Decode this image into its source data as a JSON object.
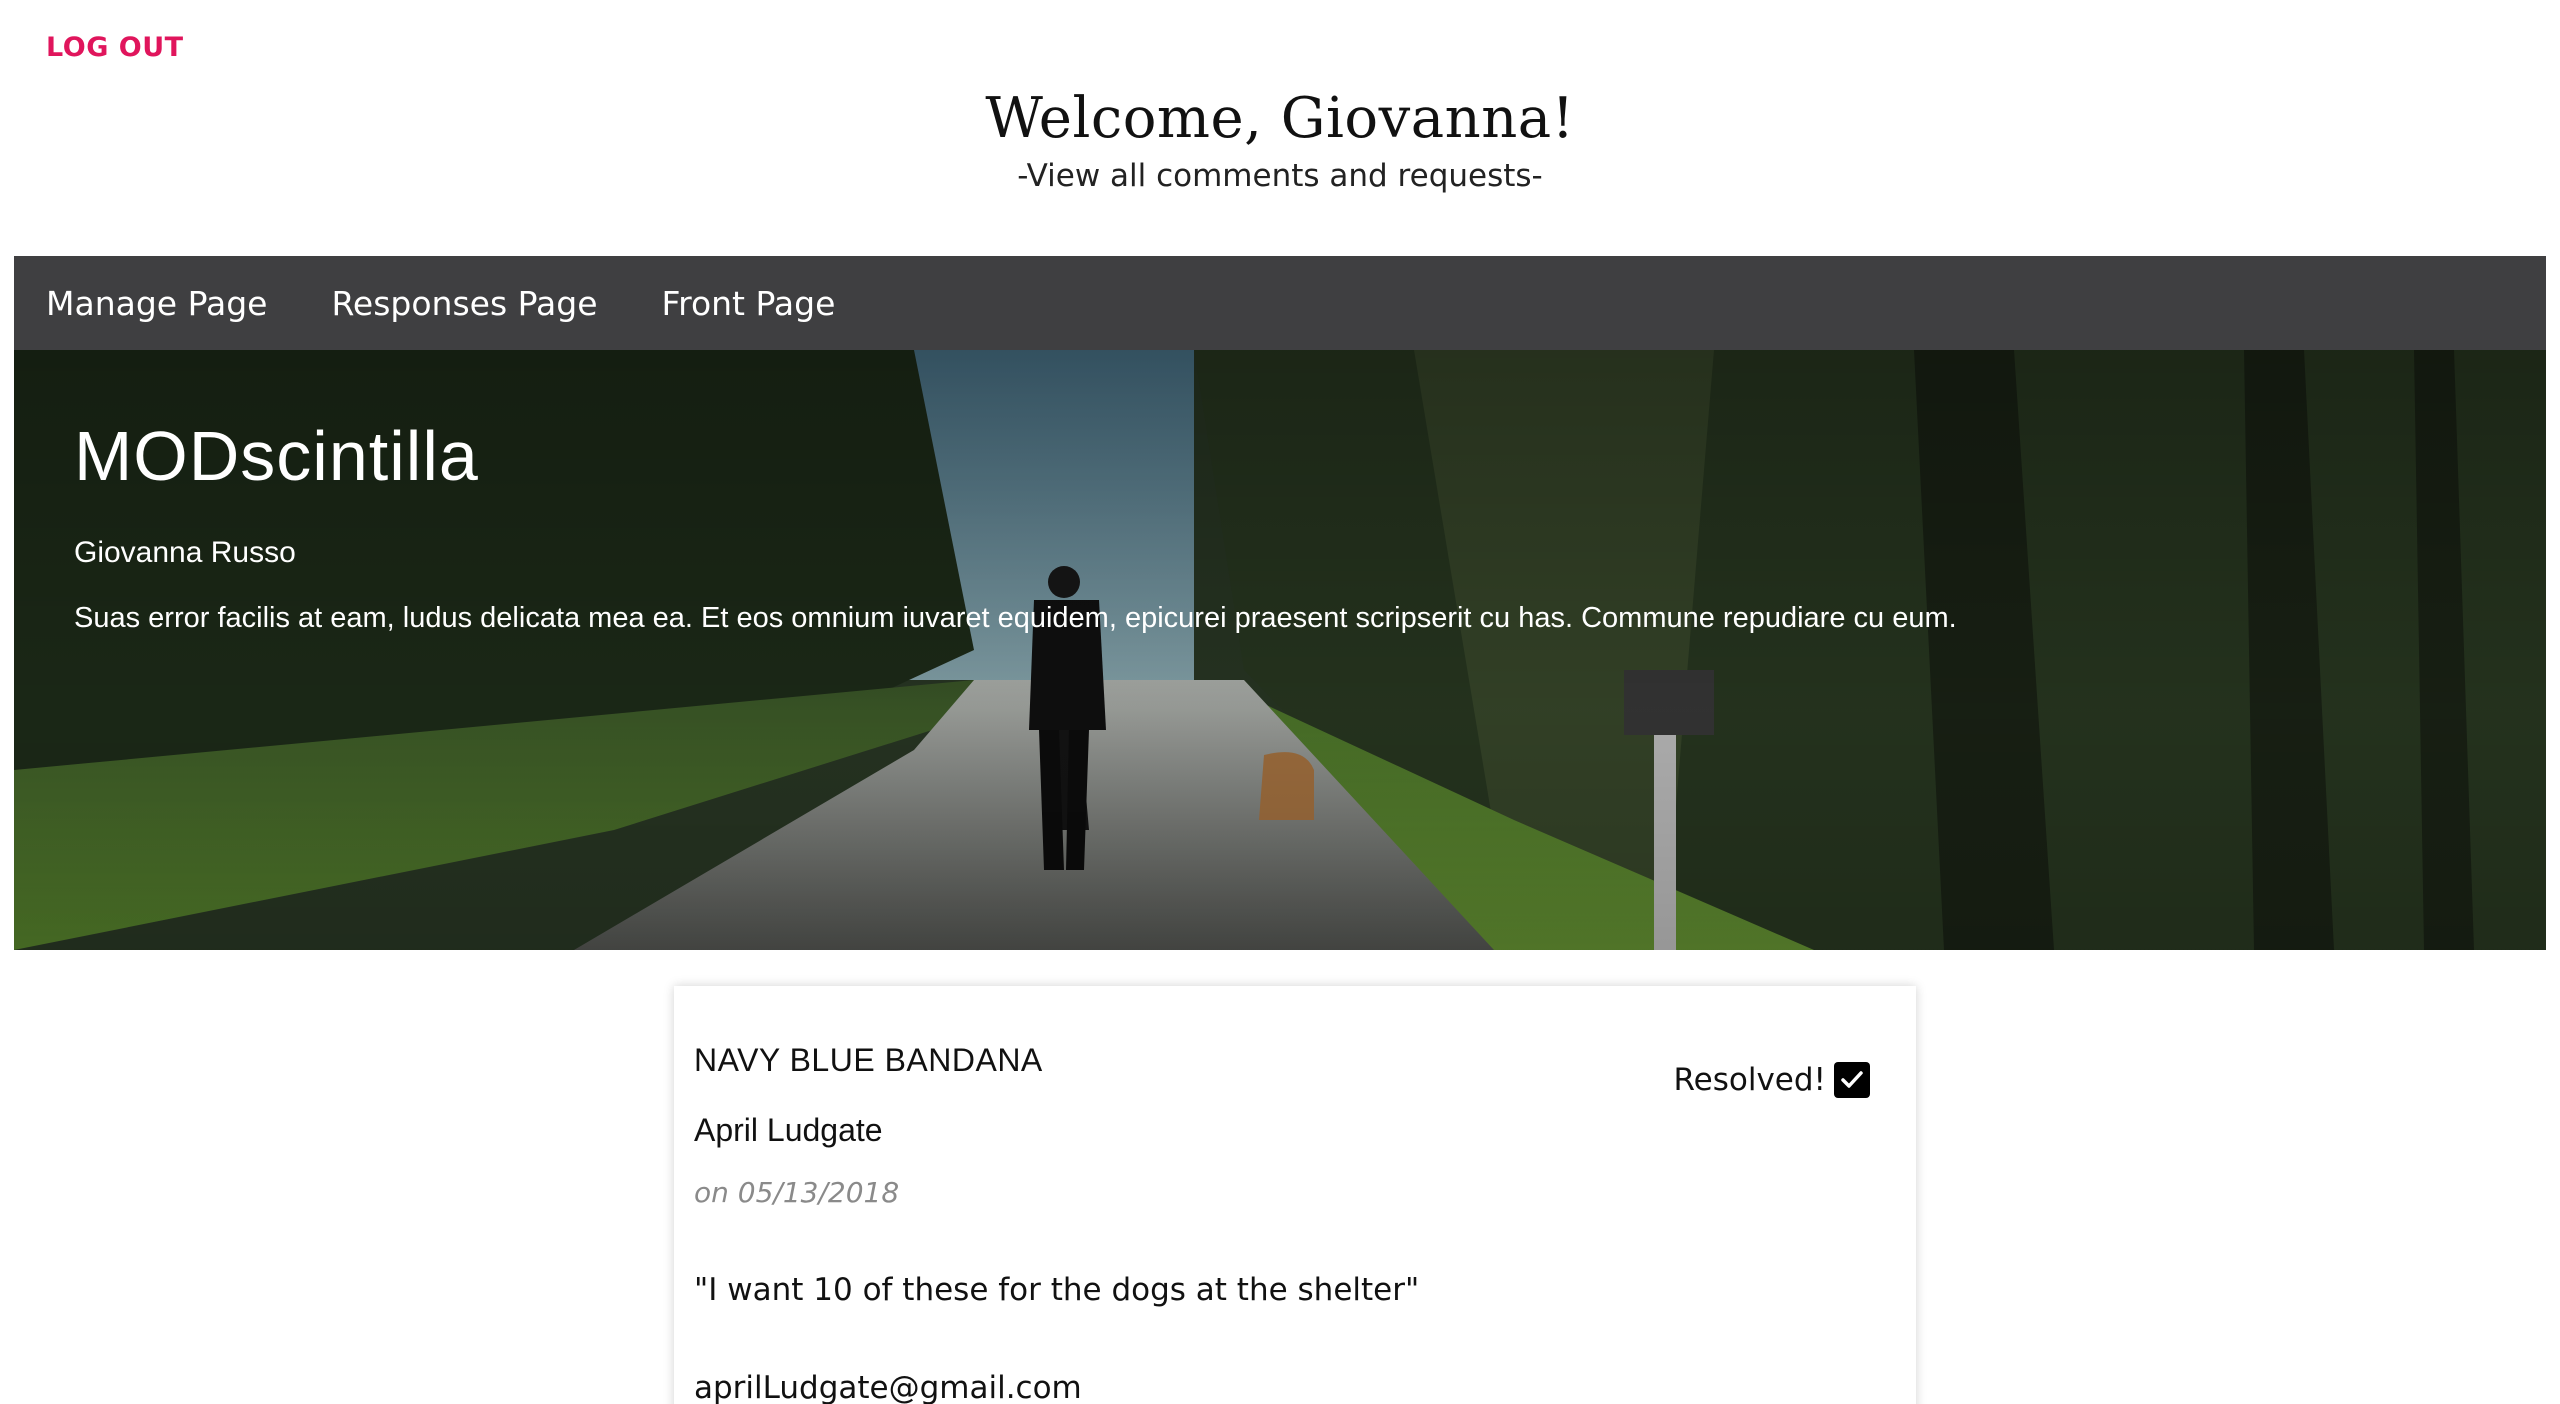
{
  "header": {
    "logout_label": "LOG OUT",
    "welcome": "Welcome, Giovanna!",
    "subtitle": "-View all comments and requests-"
  },
  "nav": {
    "items": [
      {
        "label": "Manage Page"
      },
      {
        "label": "Responses Page"
      },
      {
        "label": "Front Page"
      }
    ]
  },
  "hero": {
    "title": "MODscintilla",
    "author": "Giovanna Russo",
    "description": "Suas error facilis at eam, ludus delicata mea ea. Et eos omnium iuvaret equidem, epicurei praesent scripserit cu has. Commune repudiare cu eum.",
    "image_icon": "landscape-photo-woman-walking-dog-on-road"
  },
  "comment": {
    "title": "NAVY BLUE BANDANA",
    "name": "April Ludgate",
    "date": "on 05/13/2018",
    "text": "\"I want 10 of these for the dogs at the shelter\"",
    "email": "aprilLudgate@gmail.com",
    "resolved_label": "Resolved!",
    "resolved_checked": true
  },
  "colors": {
    "accent": "#e0155c",
    "navbar": "#3f3f41"
  }
}
